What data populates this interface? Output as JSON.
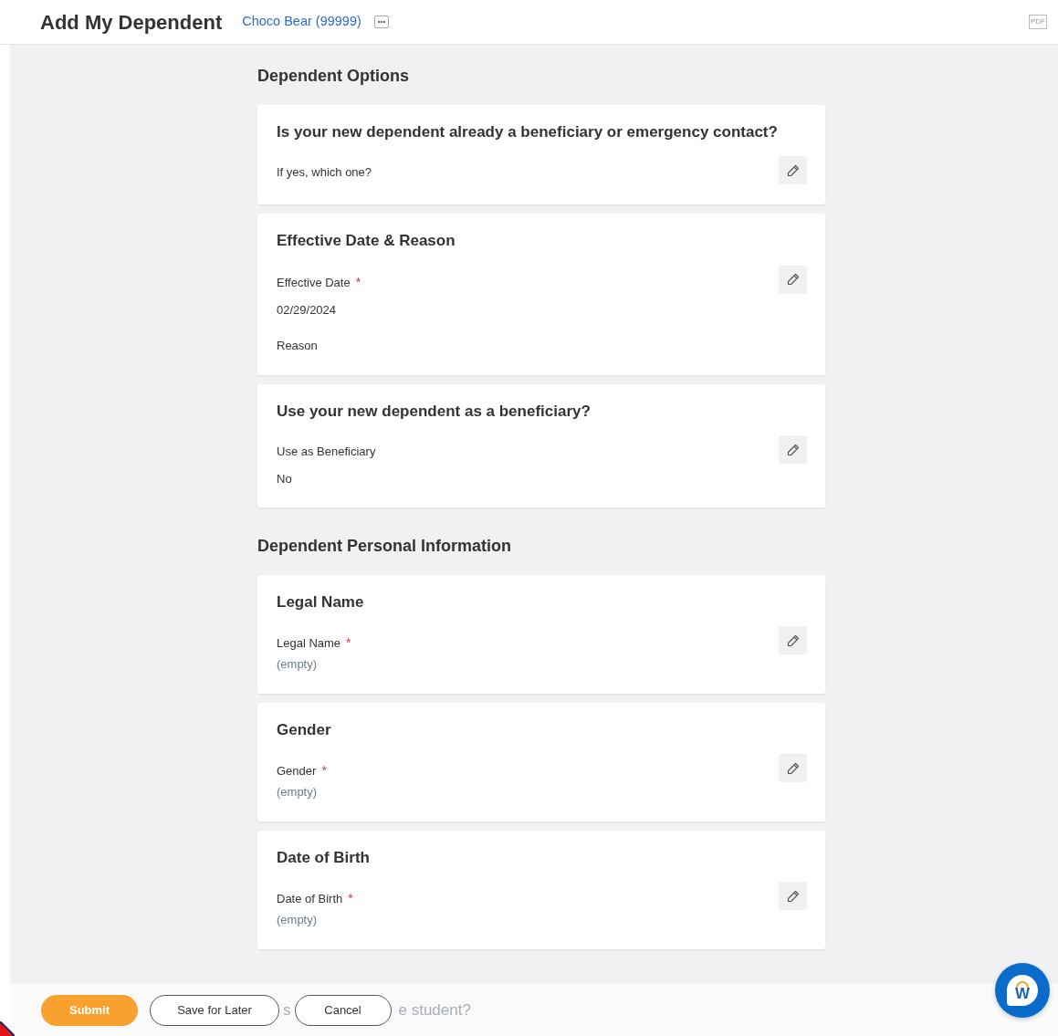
{
  "header": {
    "title": "Add My Dependent",
    "worker_link": "Choco Bear (99999)",
    "more_button": "•••",
    "pdf_button": "PDF"
  },
  "sections": [
    {
      "heading": "Dependent Options",
      "cards": [
        {
          "title": "Is your new dependent already a beneficiary or emergency contact?",
          "fields": [
            {
              "label": "If yes, which one?",
              "required": false
            }
          ]
        },
        {
          "title": "Effective Date & Reason",
          "fields": [
            {
              "label": "Effective Date",
              "required": true,
              "value": "02/29/2024",
              "empty": false
            },
            {
              "label": "Reason",
              "required": false
            }
          ]
        },
        {
          "title": "Use your new dependent as a beneficiary?",
          "fields": [
            {
              "label": "Use as Beneficiary",
              "required": false,
              "value": "No",
              "empty": false
            }
          ]
        }
      ]
    },
    {
      "heading": "Dependent Personal Information",
      "cards": [
        {
          "title": "Legal Name",
          "fields": [
            {
              "label": "Legal Name",
              "required": true,
              "value": "(empty)",
              "empty": true
            }
          ]
        },
        {
          "title": "Gender",
          "fields": [
            {
              "label": "Gender",
              "required": true,
              "value": "(empty)",
              "empty": true
            }
          ]
        },
        {
          "title": "Date of Birth",
          "fields": [
            {
              "label": "Date of Birth",
              "required": true,
              "value": "(empty)",
              "empty": true
            }
          ]
        }
      ]
    }
  ],
  "required_mark": "*",
  "footer": {
    "submit": "Submit",
    "save": "Save for Later",
    "cancel": "Cancel",
    "hidden_text_fragments": [
      "s",
      "e student?"
    ]
  },
  "chat_button": "W"
}
